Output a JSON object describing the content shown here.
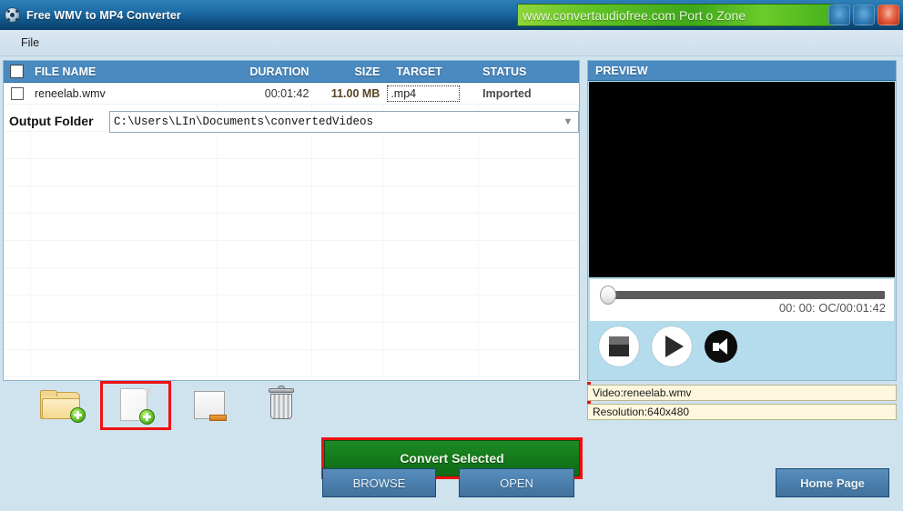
{
  "window": {
    "title": "Free WMV to MP4 Converter",
    "app_icon": "film-reel-icon",
    "banner_text": "www.convertaudiofree.com Port o Zone",
    "minimize_label": "–",
    "maximize_label": "□",
    "close_label": "✕"
  },
  "menubar": {
    "items": [
      {
        "label": "File"
      }
    ]
  },
  "file_list": {
    "columns": [
      "FILE NAME",
      "DURATION",
      "SIZE",
      "TARGET",
      "STATUS"
    ],
    "rows": [
      {
        "checked": false,
        "file_name": "reneelab.wmv",
        "duration": "00:01:42",
        "size": "11.00 MB",
        "target": ".mp4",
        "status": "Imported"
      }
    ],
    "empty_row_count": 10
  },
  "preview": {
    "header": "PREVIEW",
    "time_display": "00: 00: OC/00:01:42",
    "seek_position_percent": 0,
    "controls": [
      {
        "name": "stop-button",
        "label": "Stop"
      },
      {
        "name": "play-button",
        "label": "Play"
      },
      {
        "name": "volume-button",
        "label": "Volume"
      }
    ],
    "info": {
      "video": "Video:reneelab.wmv",
      "resolution": "Resolution:640x480"
    }
  },
  "toolbar": {
    "buttons": [
      {
        "name": "add-folder-button",
        "icon": "folder-plus-icon",
        "highlighted": false
      },
      {
        "name": "add-file-button",
        "icon": "page-plus-icon",
        "highlighted": true
      },
      {
        "name": "remove-file-button",
        "icon": "page-minus-icon",
        "highlighted": false
      },
      {
        "name": "clear-list-button",
        "icon": "trash-icon",
        "highlighted": false
      }
    ],
    "convert_label": "Convert Selected"
  },
  "output": {
    "label": "Output Folder",
    "path": "C:\\Users\\LIn\\Documents\\convertedVideos",
    "dropdown_icon": "chevron-down-icon"
  },
  "bottom_buttons": {
    "browse": "BROWSE",
    "open": "OPEN",
    "home_page": "Home Page"
  },
  "colors": {
    "titlebar": "#1d6ca6",
    "header_blue": "#4a8ac0",
    "panel_blue": "#b4dcec",
    "convert_green": "#147a1b",
    "highlight_red": "#ee1111",
    "info_cream": "#fcf7dd"
  }
}
